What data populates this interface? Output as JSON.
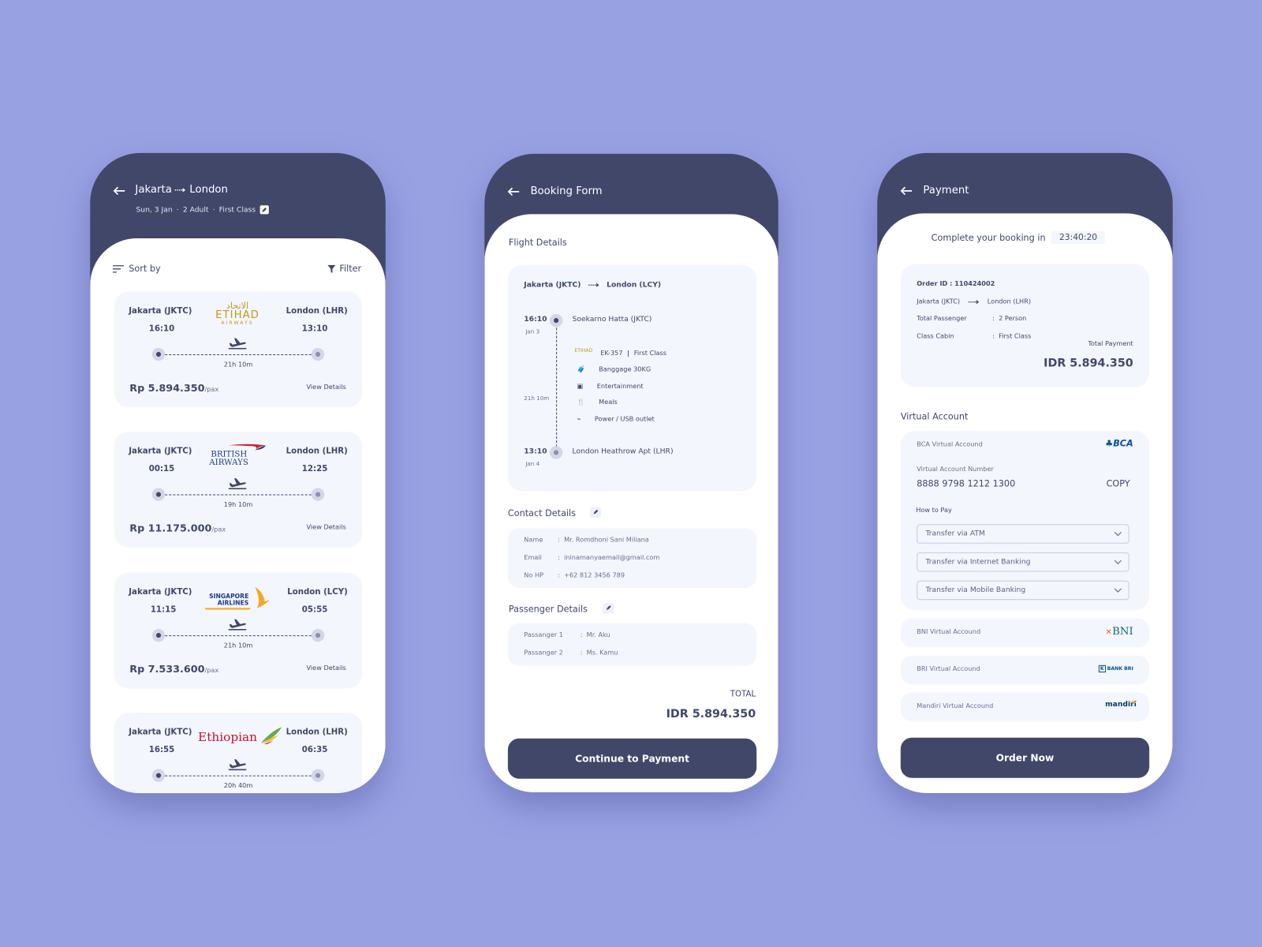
{
  "colors": {
    "background": "#98a2e3",
    "primary": "#414769",
    "card": "#f3f6fd"
  },
  "search": {
    "title_from": "Jakarta",
    "title_to": "London",
    "subtitle_date": "Sun, 3 Jan",
    "subtitle_pax": "2 Adult",
    "subtitle_class": "First Class",
    "sort_label": "Sort by",
    "filter_label": "Filter",
    "flights": [
      {
        "airline": "Etihad Airways",
        "logo_text": "ETIHAD",
        "logo_sub": "AIRWAYS",
        "origin": "Jakarta (JKTC)",
        "depart": "16:10",
        "destination": "London (LHR)",
        "arrive": "13:10",
        "duration": "21h 10m",
        "price": "Rp 5.894.350",
        "per": "/pax",
        "details": "View Details"
      },
      {
        "airline": "British Airways",
        "logo_text": "BRITISH",
        "logo_sub": "AIRWAYS",
        "origin": "Jakarta (JKTC)",
        "depart": "00:15",
        "destination": "London (LHR)",
        "arrive": "12:25",
        "duration": "19h 10m",
        "price": "Rp 11.175.000",
        "per": "/pax",
        "details": "View Details"
      },
      {
        "airline": "Singapore Airlines",
        "logo_text": "SINGAPORE",
        "logo_sub": "AIRLINES",
        "origin": "Jakarta (JKTC)",
        "depart": "11:15",
        "destination": "London (LCY)",
        "arrive": "05:55",
        "duration": "21h 10m",
        "price": "Rp 7.533.600",
        "per": "/pax",
        "details": "View Details"
      },
      {
        "airline": "Ethiopian",
        "logo_text": "Ethiopian",
        "origin": "Jakarta (JKTC)",
        "depart": "16:55",
        "destination": "London (LHR)",
        "arrive": "06:35",
        "duration": "20h 40m"
      }
    ]
  },
  "booking": {
    "title": "Booking Form",
    "flight_details_label": "Flight Details",
    "route_from": "Jakarta (JKTC)",
    "route_to": "London (LCY)",
    "depart_time": "16:10",
    "depart_date": "Jan 3",
    "depart_airport": "Soekarno Hatta (JKTC)",
    "duration": "21h 10m",
    "arrive_time": "13:10",
    "arrive_date": "Jan 4",
    "arrive_airport": "London Heathrow Apt (LHR)",
    "flight_no": "EK-357",
    "cabin": "First Class",
    "amenities": [
      {
        "icon": "luggage-icon",
        "label": "Banggage 30KG"
      },
      {
        "icon": "tv-icon",
        "label": "Entertainment"
      },
      {
        "icon": "meals-icon",
        "label": "Meals"
      },
      {
        "icon": "plug-icon",
        "label": "Power / USB outlet"
      }
    ],
    "contact_label": "Contact Details",
    "contact": [
      {
        "label": "Name",
        "value": "Mr. Romdhoni Sani Miliana"
      },
      {
        "label": "Email",
        "value": "ininamanyaemail@gmail.com"
      },
      {
        "label": "No HP",
        "value": "+62 812 3456 789"
      }
    ],
    "passenger_label": "Passenger Details",
    "passengers": [
      {
        "label": "Passanger 1",
        "value": "Mr. Aku"
      },
      {
        "label": "Passanger 2",
        "value": "Ms. Kamu"
      }
    ],
    "total_label": "TOTAL",
    "total": "IDR 5.894.350",
    "continue_label": "Continue to Payment"
  },
  "payment": {
    "title": "Payment",
    "countdown_label": "Complete your booking in",
    "countdown": "23:40:20",
    "order_id": "Order ID : 110424002",
    "route_from": "Jakarta (JKTC)",
    "route_to": "London (LHR)",
    "passenger_label": "Total Passenger",
    "passenger_value": "2 Person",
    "class_label": "Class Cabin",
    "class_value": "First Class",
    "total_label": "Total Payment",
    "total": "IDR 5.894.350",
    "va_label": "Virtual Account",
    "bca": {
      "name": "BCA Virtual Accound",
      "logo": "BCA",
      "number_label": "Virtual Account Number",
      "number": "8888 9798 1212 1300",
      "copy": "COPY",
      "how_label": "How to Pay",
      "methods": [
        "Transfer via ATM",
        "Transfer via Internet Banking",
        "Transfer via Mobile Banking"
      ]
    },
    "banks": [
      {
        "name": "BNI Virtual Accound",
        "logo": "BNI"
      },
      {
        "name": "BRI Virtual Accound",
        "logo": "BANK BRI"
      },
      {
        "name": "Mandiri Virtual Accound",
        "logo": "mandiri"
      }
    ],
    "order_label": "Order Now"
  }
}
